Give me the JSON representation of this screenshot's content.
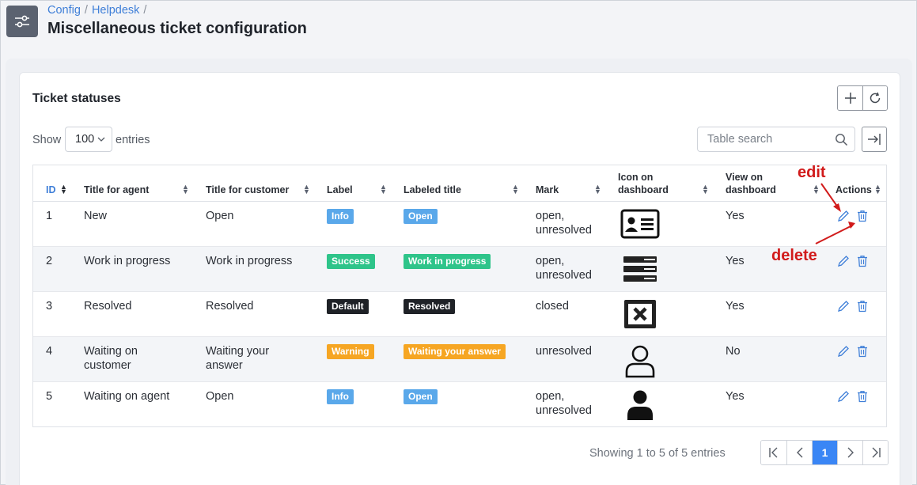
{
  "breadcrumb": {
    "items": [
      "Config",
      "Helpdesk"
    ],
    "separator": "/"
  },
  "page": {
    "title": "Miscellaneous ticket configuration"
  },
  "card": {
    "title": "Ticket statuses"
  },
  "controls": {
    "show_label": "Show",
    "entries_value": "100",
    "entries_label": "entries",
    "search_placeholder": "Table search"
  },
  "table": {
    "columns": [
      "ID",
      "Title for agent",
      "Title for customer",
      "Label",
      "Labeled title",
      "Mark",
      "Icon on dashboard",
      "View on dashboard",
      "Actions"
    ],
    "rows": [
      {
        "id": "1",
        "agent": "New",
        "customer": "Open",
        "label": "Info",
        "labeled": "Open",
        "mark": "open, unresolved",
        "icon": "id-card-icon",
        "view": "Yes"
      },
      {
        "id": "2",
        "agent": "Work in progress",
        "customer": "Work in progress",
        "label": "Success",
        "labeled": "Work in progress",
        "mark": "open, unresolved",
        "icon": "server-stack-icon",
        "view": "Yes"
      },
      {
        "id": "3",
        "agent": "Resolved",
        "customer": "Resolved",
        "label": "Default",
        "labeled": "Resolved",
        "mark": "closed",
        "icon": "close-box-icon",
        "view": "Yes"
      },
      {
        "id": "4",
        "agent": "Waiting on customer",
        "customer": "Waiting your answer",
        "label": "Warning",
        "labeled": "Waiting your answer",
        "mark": "unresolved",
        "icon": "user-outline-icon",
        "view": "No"
      },
      {
        "id": "5",
        "agent": "Waiting on agent",
        "customer": "Open",
        "label": "Info",
        "labeled": "Open",
        "mark": "open, unresolved",
        "icon": "user-solid-icon",
        "view": "Yes"
      }
    ]
  },
  "footer": {
    "info": "Showing 1 to 5 of 5 entries",
    "current_page": "1"
  },
  "annotations": {
    "edit": "edit",
    "delete": "delete"
  },
  "colors": {
    "info": "#5aa8ea",
    "success": "#2ec48a",
    "default": "#1f2227",
    "warning": "#f6a623",
    "link": "#3f7fd8",
    "annotation": "#d11a1a",
    "page_active": "#3a86f5"
  }
}
